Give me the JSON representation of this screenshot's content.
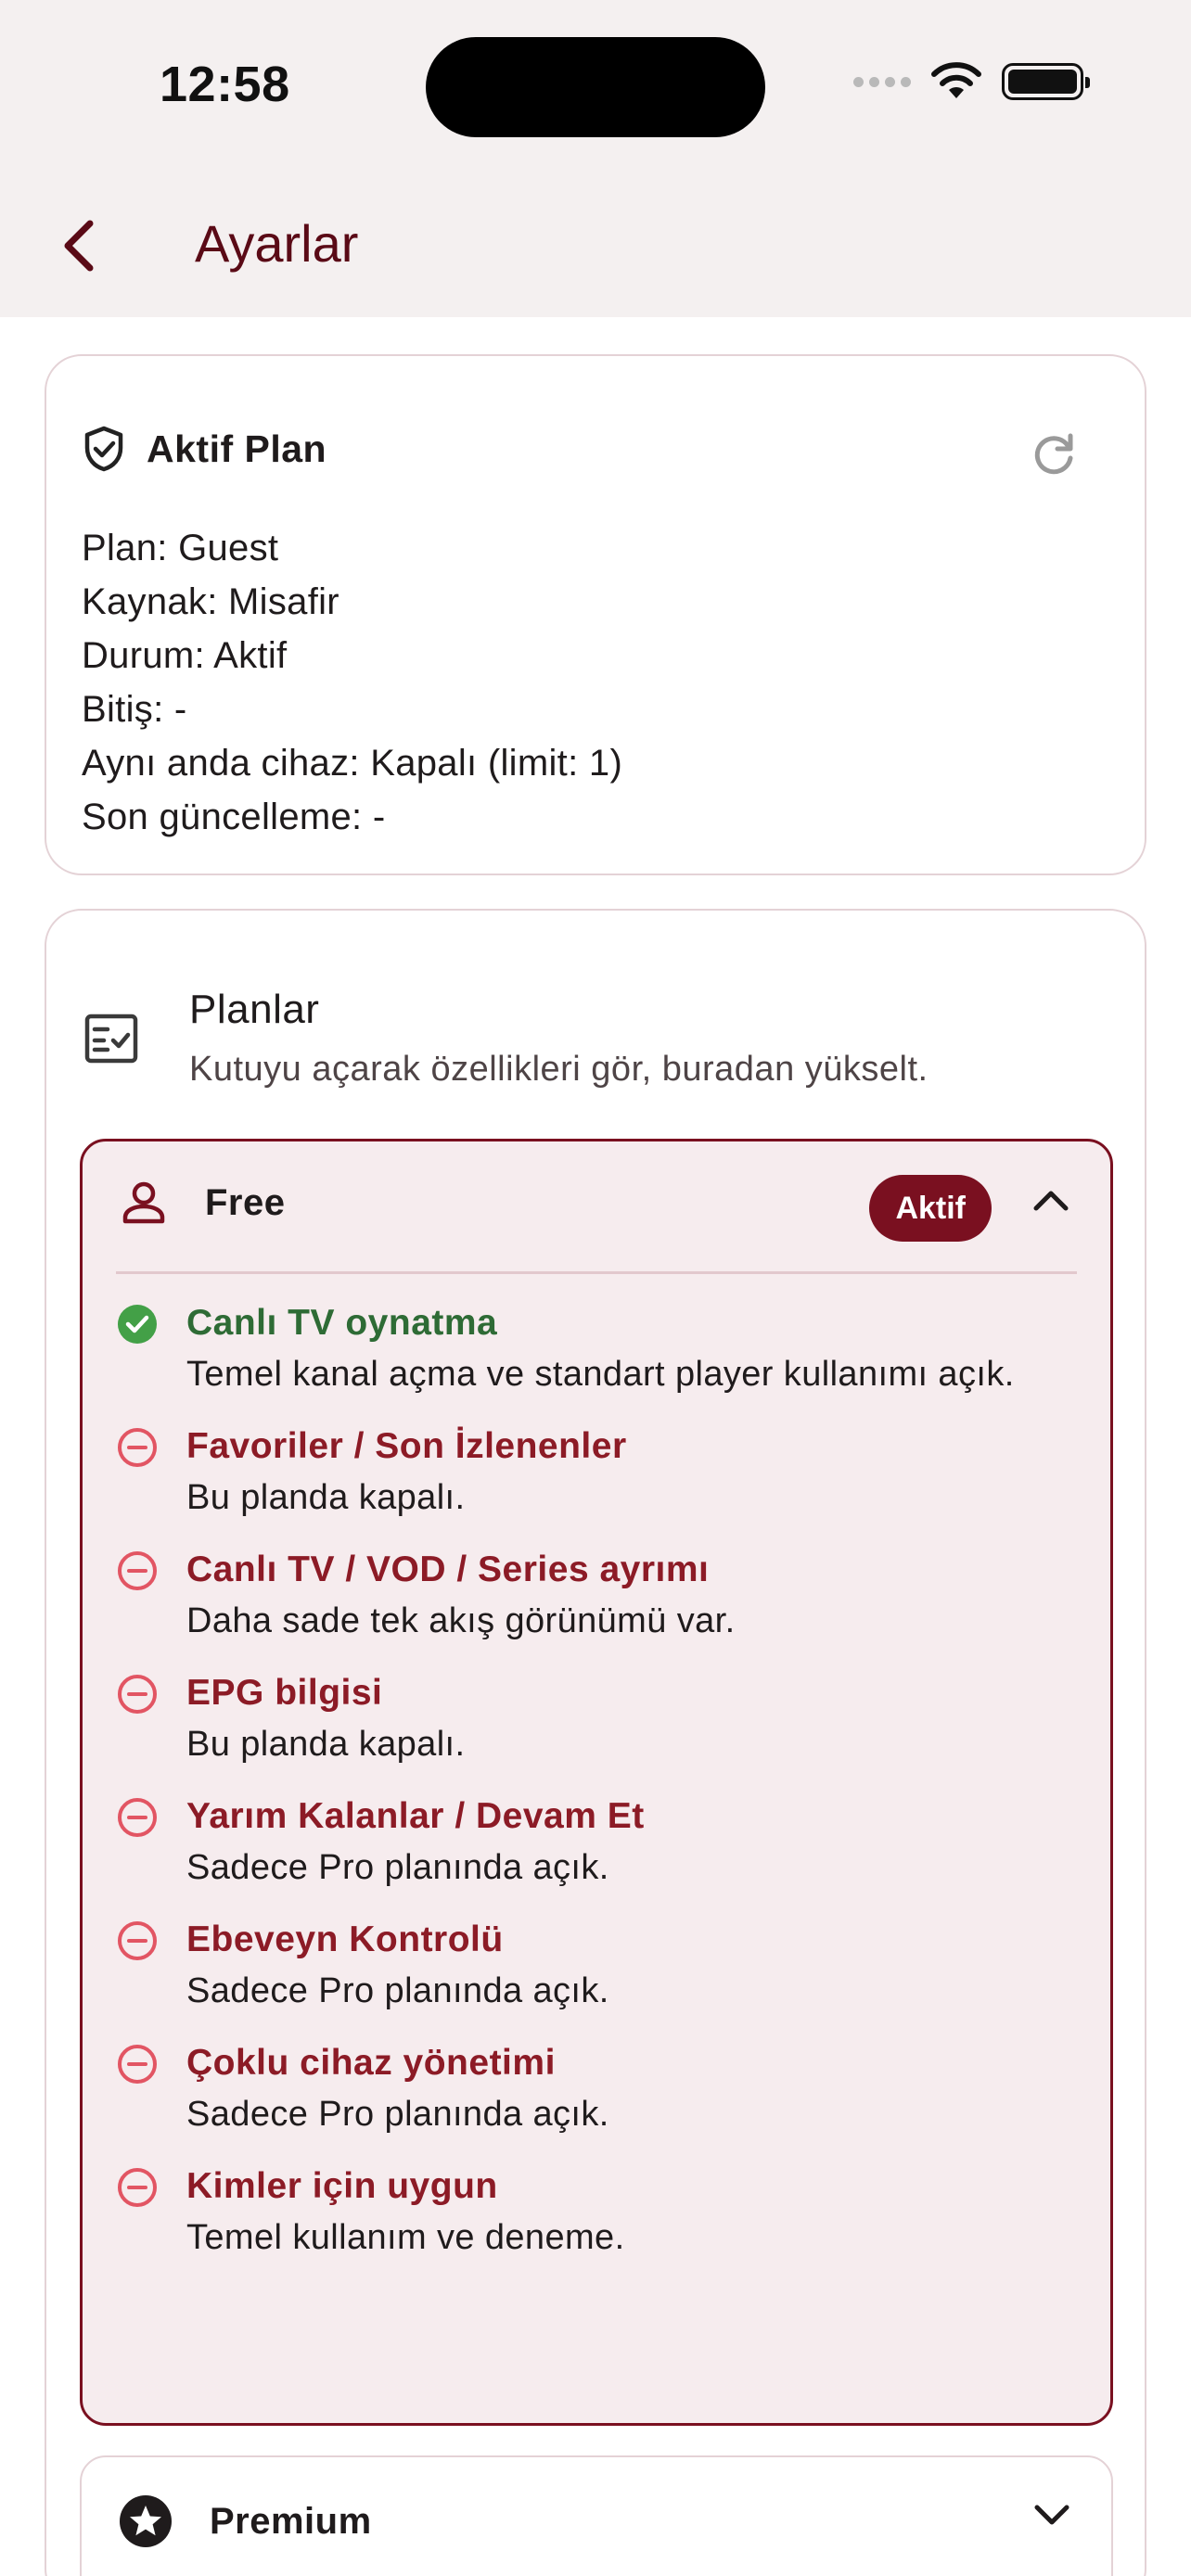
{
  "status_bar": {
    "time": "12:58"
  },
  "app_bar": {
    "title": "Ayarlar"
  },
  "active_plan": {
    "title": "Aktif Plan",
    "lines": [
      "Plan: Guest",
      "Kaynak: Misafir",
      "Durum: Aktif",
      "Bitiş: -",
      "Aynı anda cihaz: Kapalı (limit: 1)",
      "Son güncelleme: -"
    ]
  },
  "plans": {
    "title": "Planlar",
    "subtitle": "Kutuyu açarak özellikleri gör, buradan yükselt.",
    "free": {
      "name": "Free",
      "badge": "Aktif",
      "features": [
        {
          "title": "Canlı TV oynatma",
          "desc": "Temel kanal açma ve standart player kullanımı açık.",
          "enabled": true
        },
        {
          "title": "Favoriler / Son İzlenenler",
          "desc": "Bu planda kapalı.",
          "enabled": false
        },
        {
          "title": "Canlı TV / VOD / Series ayrımı",
          "desc": "Daha sade tek akış görünümü var.",
          "enabled": false
        },
        {
          "title": "EPG bilgisi",
          "desc": "Bu planda kapalı.",
          "enabled": false
        },
        {
          "title": "Yarım Kalanlar / Devam Et",
          "desc": "Sadece Pro planında açık.",
          "enabled": false
        },
        {
          "title": "Ebeveyn Kontrolü",
          "desc": "Sadece Pro planında açık.",
          "enabled": false
        },
        {
          "title": "Çoklu cihaz yönetimi",
          "desc": "Sadece Pro planında açık.",
          "enabled": false
        },
        {
          "title": "Kimler için uygun",
          "desc": "Temel kullanım ve deneme.",
          "enabled": false
        }
      ]
    },
    "premium": {
      "name": "Premium"
    }
  },
  "colors": {
    "accent": "#7a1020",
    "enabled_green": "#2e6b35",
    "disabled_red": "#8c1b26",
    "check_green": "#43a047",
    "minus_red": "#e25563"
  }
}
